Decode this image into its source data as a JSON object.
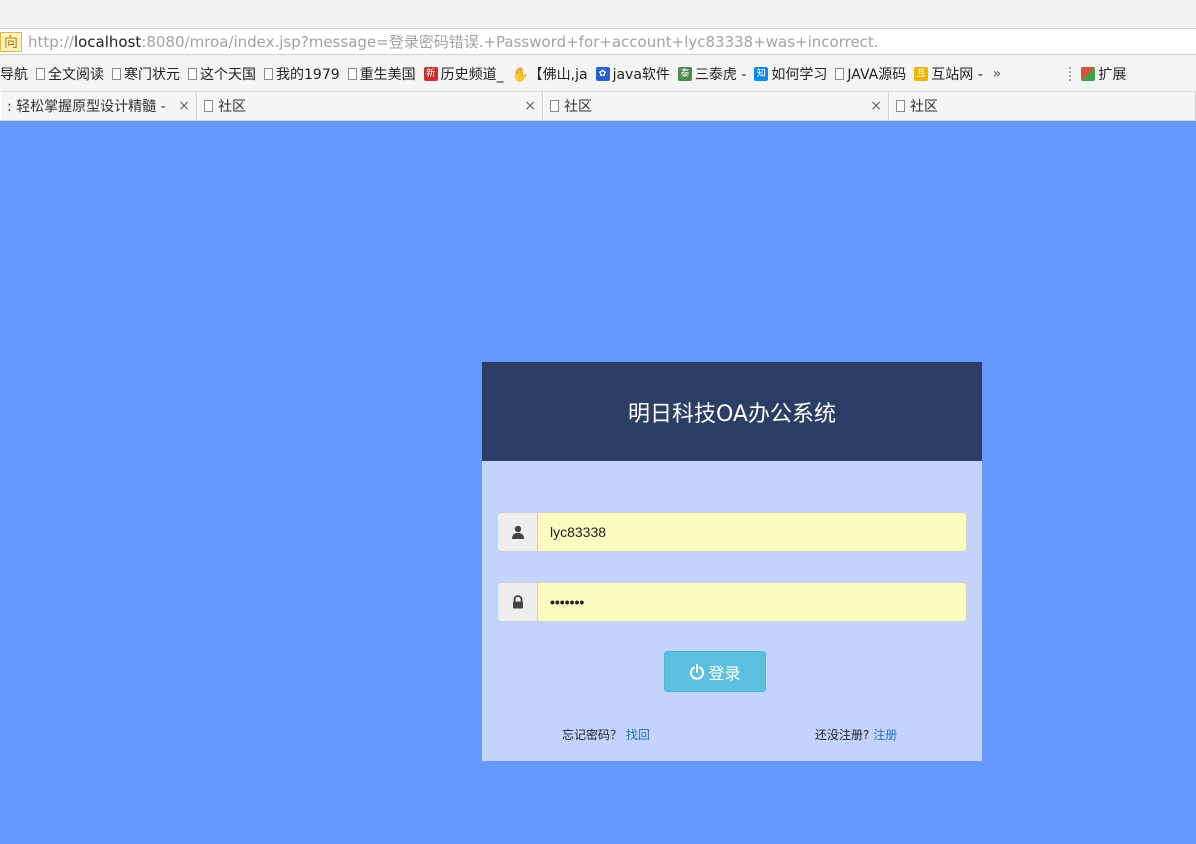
{
  "browser": {
    "address_badge": "向",
    "url_prefix": "http://",
    "url_host": "localhost",
    "url_rest": ":8080/mroa/index.jsp?message=登录密码错误.+Password+for+account+lyc83338+was+incorrect.",
    "bookmarks": [
      {
        "label": "导航",
        "icon": "none"
      },
      {
        "label": "全文阅读",
        "icon": "doc"
      },
      {
        "label": "寒门状元",
        "icon": "doc"
      },
      {
        "label": "这个天国",
        "icon": "doc"
      },
      {
        "label": "我的1979",
        "icon": "doc"
      },
      {
        "label": "重生美国",
        "icon": "doc"
      },
      {
        "label": "历史频道_",
        "icon": "red-badge"
      },
      {
        "label": "【佛山,ja",
        "icon": "hand"
      },
      {
        "label": "java软件",
        "icon": "paw"
      },
      {
        "label": "三泰虎 -",
        "icon": "green-badge"
      },
      {
        "label": "如何学习",
        "icon": "zhihu"
      },
      {
        "label": "JAVA源码",
        "icon": "doc"
      },
      {
        "label": "互站网 -",
        "icon": "yellow-badge"
      }
    ],
    "bookmarks_more": "»",
    "extensions_label": "扩展",
    "tabs": [
      {
        "label": ": 轻松掌握原型设计精髓 -",
        "close": "×"
      },
      {
        "label": "社区",
        "close": "×"
      },
      {
        "label": "社区",
        "close": "×"
      },
      {
        "label": "社区",
        "close": ""
      }
    ]
  },
  "login": {
    "title": "明日科技OA办公系统",
    "username_value": "lyc83338",
    "password_value": "•••••••",
    "submit_label": "登录",
    "forgot_text": "忘记密码？",
    "forgot_link": "找回",
    "register_text": "还没注册?",
    "register_link": "注册"
  },
  "colors": {
    "page_bg": "#6699ff",
    "panel_bg": "#c4d4ff",
    "header_bg": "#2c3e66",
    "input_bg": "#fafcc0",
    "button_bg": "#5bc0de",
    "link": "#2a6ebb"
  }
}
